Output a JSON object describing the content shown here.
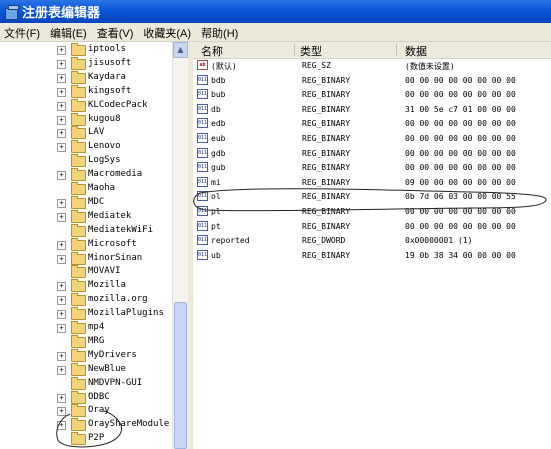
{
  "window": {
    "title": "注册表编辑器"
  },
  "menu": [
    "文件(F)",
    "编辑(E)",
    "查看(V)",
    "收藏夹(A)",
    "帮助(H)"
  ],
  "tree": [
    {
      "label": "iptools",
      "exp": "+"
    },
    {
      "label": "jisusoft",
      "exp": "+"
    },
    {
      "label": "Kaydara",
      "exp": "+"
    },
    {
      "label": "kingsoft",
      "exp": "+"
    },
    {
      "label": "KLCodecPack",
      "exp": "+"
    },
    {
      "label": "kugou8",
      "exp": "+"
    },
    {
      "label": "LAV",
      "exp": "+"
    },
    {
      "label": "Lenovo",
      "exp": "+"
    },
    {
      "label": "LogSys",
      "exp": ""
    },
    {
      "label": "Macromedia",
      "exp": "+"
    },
    {
      "label": "Maoha",
      "exp": ""
    },
    {
      "label": "MDC",
      "exp": "+"
    },
    {
      "label": "Mediatek",
      "exp": "+"
    },
    {
      "label": "MediatekWiFi",
      "exp": ""
    },
    {
      "label": "Microsoft",
      "exp": "+"
    },
    {
      "label": "MinorSinan",
      "exp": "+"
    },
    {
      "label": "MOVAVI",
      "exp": ""
    },
    {
      "label": "Mozilla",
      "exp": "+"
    },
    {
      "label": "mozilla.org",
      "exp": "+"
    },
    {
      "label": "MozillaPlugins",
      "exp": "+"
    },
    {
      "label": "mp4",
      "exp": "+"
    },
    {
      "label": "MRG",
      "exp": ""
    },
    {
      "label": "MyDrivers",
      "exp": "+"
    },
    {
      "label": "NewBlue",
      "exp": "+"
    },
    {
      "label": "NMDVPN-GUI",
      "exp": ""
    },
    {
      "label": "ODBC",
      "exp": "+"
    },
    {
      "label": "Oray",
      "exp": "+"
    },
    {
      "label": "OrayShareModule",
      "exp": "+"
    },
    {
      "label": "P2P",
      "exp": ""
    }
  ],
  "columns": [
    "名称",
    "类型",
    "数据"
  ],
  "values": [
    {
      "name": "(默认)",
      "type": "REG_SZ",
      "data": "(数值未设置)",
      "icon": "ab"
    },
    {
      "name": "bdb",
      "type": "REG_BINARY",
      "data": "00 00 00 00 00 00 00 00",
      "icon": "bin"
    },
    {
      "name": "bub",
      "type": "REG_BINARY",
      "data": "00 00 00 00 00 00 00 00",
      "icon": "bin"
    },
    {
      "name": "db",
      "type": "REG_BINARY",
      "data": "31 00 5e c7 01 00 00 00",
      "icon": "bin"
    },
    {
      "name": "edb",
      "type": "REG_BINARY",
      "data": "00 00 00 00 00 00 00 00",
      "icon": "bin"
    },
    {
      "name": "eub",
      "type": "REG_BINARY",
      "data": "00 00 00 00 00 00 00 00",
      "icon": "bin"
    },
    {
      "name": "gdb",
      "type": "REG_BINARY",
      "data": "00 00 00 00 00 00 00 00",
      "icon": "bin"
    },
    {
      "name": "gub",
      "type": "REG_BINARY",
      "data": "00 00 00 00 00 00 00 00",
      "icon": "bin"
    },
    {
      "name": "mi",
      "type": "REG_BINARY",
      "data": "09 00 00 00 00 00 00 00",
      "icon": "bin"
    },
    {
      "name": "ol",
      "type": "REG_BINARY",
      "data": "0b 7d 06 03 00 00 00 55",
      "icon": "bin"
    },
    {
      "name": "pl",
      "type": "REG_BINARY",
      "data": "00 00 00 00 00 00 00 00",
      "icon": "bin"
    },
    {
      "name": "pt",
      "type": "REG_BINARY",
      "data": "00 00 00 00 00 00 00 00",
      "icon": "bin"
    },
    {
      "name": "reported",
      "type": "REG_DWORD",
      "data": "0x00000001 (1)",
      "icon": "bin"
    },
    {
      "name": "ub",
      "type": "REG_BINARY",
      "data": "19 0b 38 34 00 00 00 00",
      "icon": "bin"
    }
  ],
  "icons": {
    "app": "registry-cube-icon",
    "folder": "folder-icon",
    "string_value": "string-value-icon",
    "binary_value": "binary-value-icon",
    "scroll_up": "scroll-up-arrow-icon"
  },
  "colors": {
    "titlebar": "#0a55d7",
    "menubar": "#ece9d8",
    "folder": "#f4d27a",
    "annotation": "#222222"
  }
}
